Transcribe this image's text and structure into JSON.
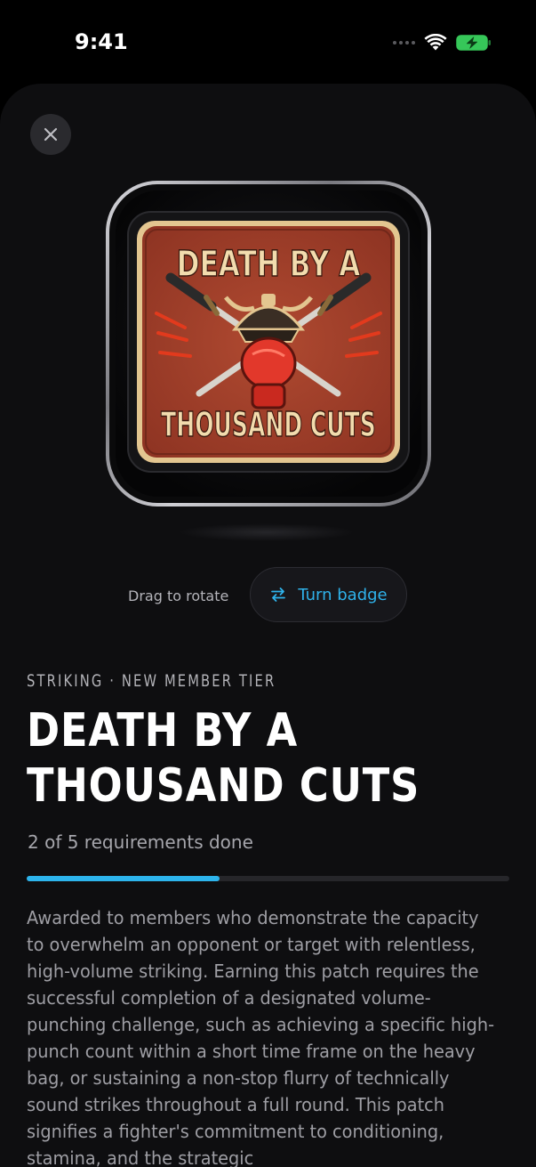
{
  "status_bar": {
    "time": "9:41"
  },
  "badge": {
    "line1": "DEATH BY A",
    "line2": "THOUSAND CUTS",
    "colors": {
      "patch": "#a8432c",
      "border": "#e3c690",
      "text": "#f2dcae"
    }
  },
  "rotate": {
    "hint": "Drag to rotate",
    "button_label": "Turn badge",
    "button_icon": "swap-arrows-icon"
  },
  "category": {
    "eyebrow": "STRIKING · NEW MEMBER TIER"
  },
  "title": "DEATH BY A THOUSAND CUTS",
  "progress": {
    "text": "2 of 5 requirements done",
    "done": 2,
    "total": 5,
    "fraction": 0.4
  },
  "description": "Awarded to members who demonstrate the capacity to overwhelm an opponent or target with relentless, high-volume striking. Earning this patch requires the successful completion of a designated volume-punching challenge, such as achieving a specific high-punch count within a short time frame on the heavy bag, or sustaining a non-stop flurry of technically sound strikes throughout a full round. This patch signifies a fighter's commitment to conditioning, stamina, and the strategic",
  "colors": {
    "accent": "#2db4ec",
    "background": "#0e0e10"
  }
}
